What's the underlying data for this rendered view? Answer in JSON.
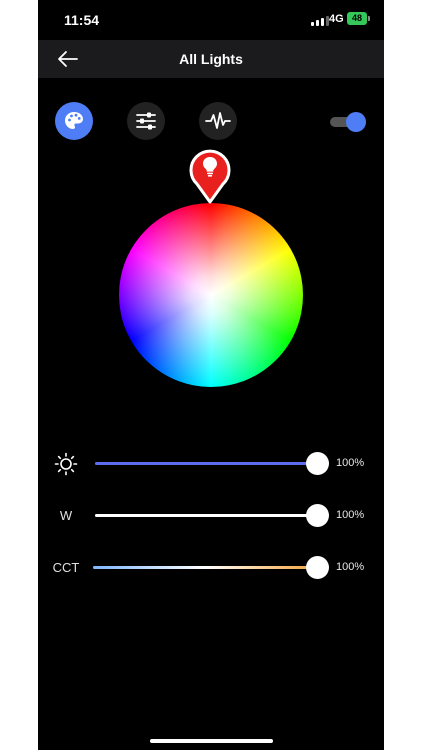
{
  "status_bar": {
    "time": "11:54",
    "network": "4G",
    "battery": "48"
  },
  "header": {
    "title": "All Lights",
    "back_icon": "arrow-left-icon"
  },
  "modes": [
    {
      "name": "color",
      "icon": "palette-icon",
      "active": true
    },
    {
      "name": "adjust",
      "icon": "sliders-icon",
      "active": false
    },
    {
      "name": "music",
      "icon": "waveform-icon",
      "active": false
    }
  ],
  "power_toggle": {
    "on": true
  },
  "color_wheel": {
    "marker_icon": "bulb-icon",
    "selected_color": "#ff0000"
  },
  "sliders": [
    {
      "name": "brightness",
      "icon": "sun-icon",
      "label": "",
      "value": "100%",
      "level": 1.0,
      "color": "#5b6cf0"
    },
    {
      "name": "white",
      "icon": "",
      "label": "W",
      "value": "100%",
      "level": 1.0,
      "color": "#ffffff"
    },
    {
      "name": "cct",
      "icon": "",
      "label": "CCT",
      "value": "100%",
      "level": 1.0,
      "color": "gradient-cool-warm"
    }
  ],
  "colors": {
    "accent": "#4f7df5",
    "header_bg": "#1b1b1d",
    "background": "#000000"
  }
}
